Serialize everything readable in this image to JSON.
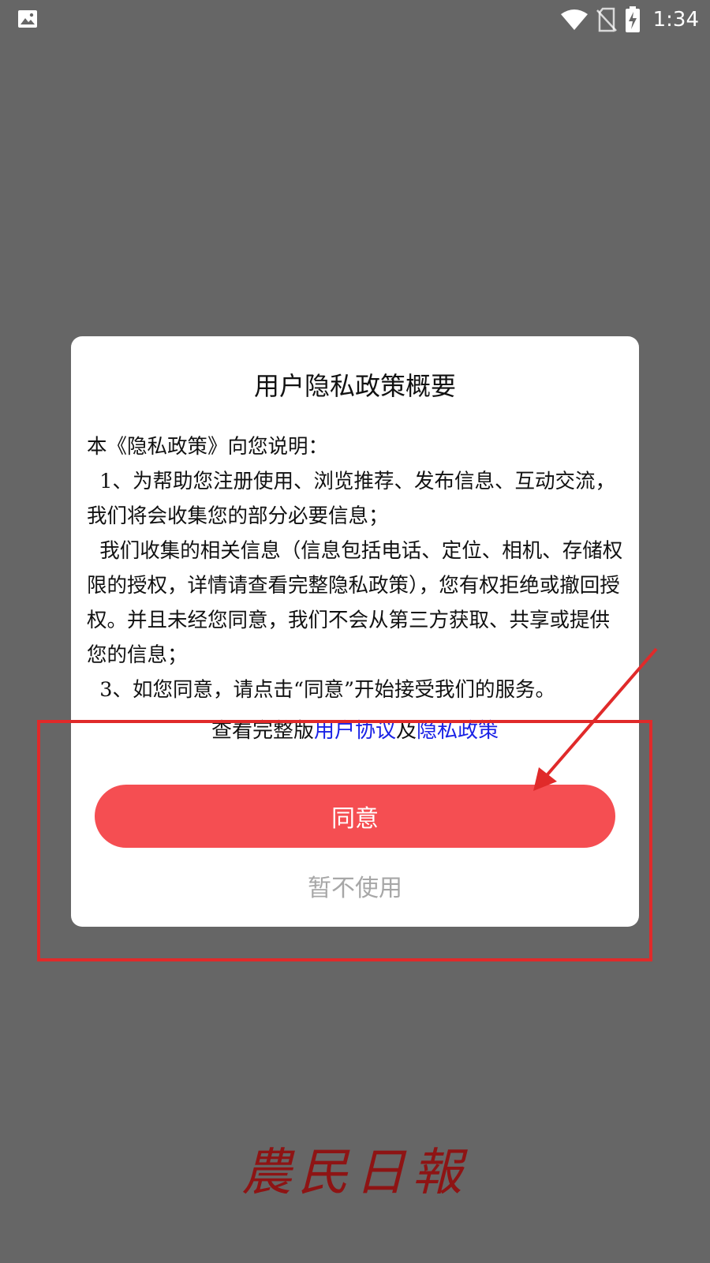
{
  "status_bar": {
    "time": "1:34",
    "icons": [
      "image-icon",
      "wifi-icon",
      "no-sim-icon",
      "battery-charging-icon"
    ]
  },
  "dialog": {
    "title": "用户隐私政策概要",
    "body": [
      "本《隐私政策》向您说明：",
      "  1、为帮助您注册使用、浏览推荐、发布信息、互动交流，  我们将会收集您的部分必要信息；",
      "  我们收集的相关信息（信息包括电话、定位、相机、存储权限的授权，详情请查看完整隐私政策），您有权拒绝或撤回授权。并且未经您同意，我们不会从第三方获取、共享或提供您的信息；",
      "  3、如您同意，请点击“同意”开始接受我们的服务。"
    ],
    "links_prefix": "查看完整版",
    "user_agreement_link": "用户协议",
    "links_joiner": "及",
    "privacy_policy_link": "隐私政策",
    "agree_label": "同意",
    "decline_label": "暂不使用"
  },
  "brand": {
    "logo_text": "農民日報"
  },
  "colors": {
    "overlay": "#666666",
    "agree_button": "#f54e52",
    "link": "#1a22e6",
    "annotation": "#e02a2a",
    "brand": "#8e1414"
  }
}
